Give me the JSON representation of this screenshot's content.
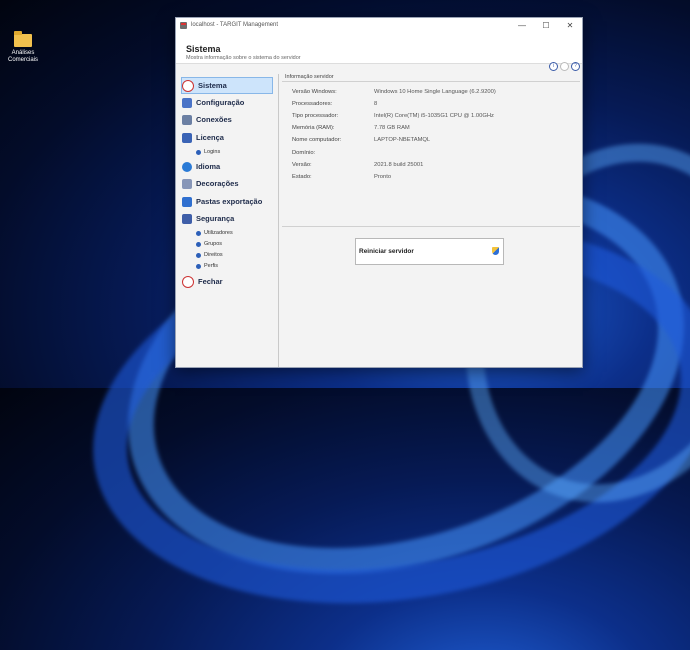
{
  "desktop": {
    "icon_label": "Análises Comerciais"
  },
  "window": {
    "title": "localhost - TARGIT Management",
    "controls": {
      "minimize": "—",
      "maximize": "☐",
      "close": "✕"
    }
  },
  "header": {
    "title": "Sistema",
    "subtitle": "Mostra informação sobre o sistema do servidor",
    "icons": [
      "info-icon",
      "blank-icon",
      "help-icon"
    ]
  },
  "sidebar": {
    "items": [
      {
        "label": "Sistema",
        "icon": "info-icon"
      },
      {
        "label": "Configuração",
        "icon": "config-icon"
      },
      {
        "label": "Conexões",
        "icon": "connections-icon"
      },
      {
        "label": "Licença",
        "icon": "license-icon",
        "sub": [
          "Logins"
        ]
      },
      {
        "label": "Idioma",
        "icon": "globe-icon"
      },
      {
        "label": "Decorações",
        "icon": "decorations-icon"
      },
      {
        "label": "Pastas exportação",
        "icon": "folder-export-icon"
      },
      {
        "label": "Segurança",
        "icon": "lock-icon",
        "sub": [
          "Utilizadores",
          "Grupos",
          "Direitos",
          "Perfis"
        ]
      },
      {
        "label": "Fechar",
        "icon": "close-icon"
      }
    ]
  },
  "info": {
    "section_title": "Informação servidor",
    "rows": [
      {
        "label": "Versão Windows:",
        "value": "Windows 10 Home Single Language (6.2.9200)"
      },
      {
        "label": "Processadores:",
        "value": "8"
      },
      {
        "label": "Tipo processador:",
        "value": "Intel(R) Core(TM) i5-1035G1 CPU @ 1.00GHz"
      },
      {
        "label": "Memória (RAM):",
        "value": "7.78 GB RAM"
      },
      {
        "label": "Nome computador:",
        "value": "LAPTOP-NBETAMQL"
      },
      {
        "label": "Domínio:",
        "value": ""
      },
      {
        "label": "Versão:",
        "value": "2021.8 build 25001"
      },
      {
        "label": "Estado:",
        "value": "Pronto"
      }
    ]
  },
  "actions": {
    "restart_label": "Reiniciar servidor"
  },
  "colors": {
    "accent": "#3b5ca8",
    "active_bg": "#cde4fb"
  }
}
